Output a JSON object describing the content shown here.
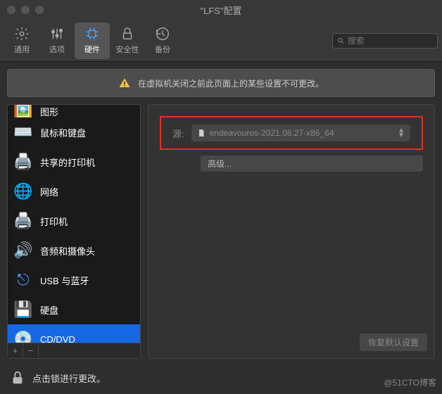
{
  "window": {
    "title": "\"LFS\"配置"
  },
  "toolbar": {
    "items": [
      {
        "label": "通用"
      },
      {
        "label": "选项"
      },
      {
        "label": "硬件"
      },
      {
        "label": "安全性"
      },
      {
        "label": "备份"
      }
    ],
    "search_placeholder": "搜索"
  },
  "notice": {
    "text": "在虚拟机关闭之前此页面上的某些设置不可更改。"
  },
  "sidebar": {
    "items": [
      {
        "label": "图形"
      },
      {
        "label": "鼠标和键盘"
      },
      {
        "label": "共享的打印机"
      },
      {
        "label": "网络"
      },
      {
        "label": "打印机"
      },
      {
        "label": "音频和摄像头"
      },
      {
        "label": "USB 与蓝牙"
      },
      {
        "label": "硬盘"
      },
      {
        "label": "CD/DVD"
      }
    ],
    "add": "+",
    "remove": "−"
  },
  "content": {
    "source_label": "源:",
    "source_value": "endeavouros-2021.08.27-x86_64",
    "advanced": "高级...",
    "restore": "恢复默认设置"
  },
  "lock": {
    "text": "点击锁进行更改。"
  },
  "watermark": "@51CTO博客"
}
